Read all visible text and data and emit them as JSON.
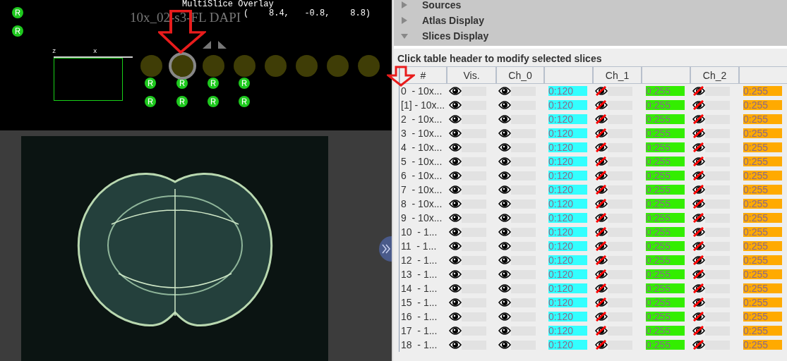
{
  "viewer": {
    "title": "MultiSlice Overlay",
    "slice_name": "10x_02-s3-FL DAPI",
    "coordinates": "(    8.4,   -0.8,    8.8)",
    "axis_labels": [
      "z",
      "x"
    ],
    "slices": [
      {
        "selected": false
      },
      {
        "selected": true
      },
      {
        "selected": false
      },
      {
        "selected": false
      },
      {
        "selected": false
      },
      {
        "selected": false
      },
      {
        "selected": false
      },
      {
        "selected": false
      }
    ]
  },
  "panel": {
    "sections": [
      {
        "title": "Sources",
        "expanded": false
      },
      {
        "title": "Atlas Display",
        "expanded": false
      },
      {
        "title": "Slices Display",
        "expanded": true
      }
    ],
    "hint": "Click table header to modify selected slices",
    "table": {
      "columns": [
        "#",
        "Vis."
      ],
      "channels": [
        {
          "name": "Ch_0",
          "color": "#33ffff"
        },
        {
          "name": "Ch_1",
          "color": "#33ee00"
        },
        {
          "name": "Ch_2",
          "color": "#ffaa00"
        }
      ],
      "rows": [
        {
          "label": "0  - 10x...",
          "visible": true,
          "channels": [
            {
              "visible": true,
              "range": "0:120"
            },
            {
              "visible": false,
              "range": "0:255"
            },
            {
              "visible": false,
              "range": "0:255"
            }
          ]
        },
        {
          "label": "[1] - 10x...",
          "visible": true,
          "channels": [
            {
              "visible": true,
              "range": "0:120"
            },
            {
              "visible": false,
              "range": "0:255"
            },
            {
              "visible": false,
              "range": "0:255"
            }
          ]
        },
        {
          "label": "2  - 10x...",
          "visible": true,
          "channels": [
            {
              "visible": true,
              "range": "0:120"
            },
            {
              "visible": false,
              "range": "0:255"
            },
            {
              "visible": false,
              "range": "0:255"
            }
          ]
        },
        {
          "label": "3  - 10x...",
          "visible": true,
          "channels": [
            {
              "visible": true,
              "range": "0:120"
            },
            {
              "visible": false,
              "range": "0:255"
            },
            {
              "visible": false,
              "range": "0:255"
            }
          ]
        },
        {
          "label": "4  - 10x...",
          "visible": true,
          "channels": [
            {
              "visible": true,
              "range": "0:120"
            },
            {
              "visible": false,
              "range": "0:255"
            },
            {
              "visible": false,
              "range": "0:255"
            }
          ]
        },
        {
          "label": "5  - 10x...",
          "visible": true,
          "channels": [
            {
              "visible": true,
              "range": "0:120"
            },
            {
              "visible": false,
              "range": "0:255"
            },
            {
              "visible": false,
              "range": "0:255"
            }
          ]
        },
        {
          "label": "6  - 10x...",
          "visible": true,
          "channels": [
            {
              "visible": true,
              "range": "0:120"
            },
            {
              "visible": false,
              "range": "0:255"
            },
            {
              "visible": false,
              "range": "0:255"
            }
          ]
        },
        {
          "label": "7  - 10x...",
          "visible": true,
          "channels": [
            {
              "visible": true,
              "range": "0:120"
            },
            {
              "visible": false,
              "range": "0:255"
            },
            {
              "visible": false,
              "range": "0:255"
            }
          ]
        },
        {
          "label": "8  - 10x...",
          "visible": true,
          "channels": [
            {
              "visible": true,
              "range": "0:120"
            },
            {
              "visible": false,
              "range": "0:255"
            },
            {
              "visible": false,
              "range": "0:255"
            }
          ]
        },
        {
          "label": "9  - 10x...",
          "visible": true,
          "channels": [
            {
              "visible": true,
              "range": "0:120"
            },
            {
              "visible": false,
              "range": "0:255"
            },
            {
              "visible": false,
              "range": "0:255"
            }
          ]
        },
        {
          "label": "10  - 1...",
          "visible": true,
          "channels": [
            {
              "visible": true,
              "range": "0:120"
            },
            {
              "visible": false,
              "range": "0:255"
            },
            {
              "visible": false,
              "range": "0:255"
            }
          ]
        },
        {
          "label": "11  - 1...",
          "visible": true,
          "channels": [
            {
              "visible": true,
              "range": "0:120"
            },
            {
              "visible": false,
              "range": "0:255"
            },
            {
              "visible": false,
              "range": "0:255"
            }
          ]
        },
        {
          "label": "12  - 1...",
          "visible": true,
          "channels": [
            {
              "visible": true,
              "range": "0:120"
            },
            {
              "visible": false,
              "range": "0:255"
            },
            {
              "visible": false,
              "range": "0:255"
            }
          ]
        },
        {
          "label": "13  - 1...",
          "visible": true,
          "channels": [
            {
              "visible": true,
              "range": "0:120"
            },
            {
              "visible": false,
              "range": "0:255"
            },
            {
              "visible": false,
              "range": "0:255"
            }
          ]
        },
        {
          "label": "14  - 1...",
          "visible": true,
          "channels": [
            {
              "visible": true,
              "range": "0:120"
            },
            {
              "visible": false,
              "range": "0:255"
            },
            {
              "visible": false,
              "range": "0:255"
            }
          ]
        },
        {
          "label": "15  - 1...",
          "visible": true,
          "channels": [
            {
              "visible": true,
              "range": "0:120"
            },
            {
              "visible": false,
              "range": "0:255"
            },
            {
              "visible": false,
              "range": "0:255"
            }
          ]
        },
        {
          "label": "16  - 1...",
          "visible": true,
          "channels": [
            {
              "visible": true,
              "range": "0:120"
            },
            {
              "visible": false,
              "range": "0:255"
            },
            {
              "visible": false,
              "range": "0:255"
            }
          ]
        },
        {
          "label": "17  - 1...",
          "visible": true,
          "channels": [
            {
              "visible": true,
              "range": "0:120"
            },
            {
              "visible": false,
              "range": "0:255"
            },
            {
              "visible": false,
              "range": "0:255"
            }
          ]
        },
        {
          "label": "18  - 1...",
          "visible": true,
          "channels": [
            {
              "visible": true,
              "range": "0:120"
            },
            {
              "visible": false,
              "range": "0:255"
            },
            {
              "visible": false,
              "range": "0:255"
            }
          ]
        }
      ]
    }
  }
}
